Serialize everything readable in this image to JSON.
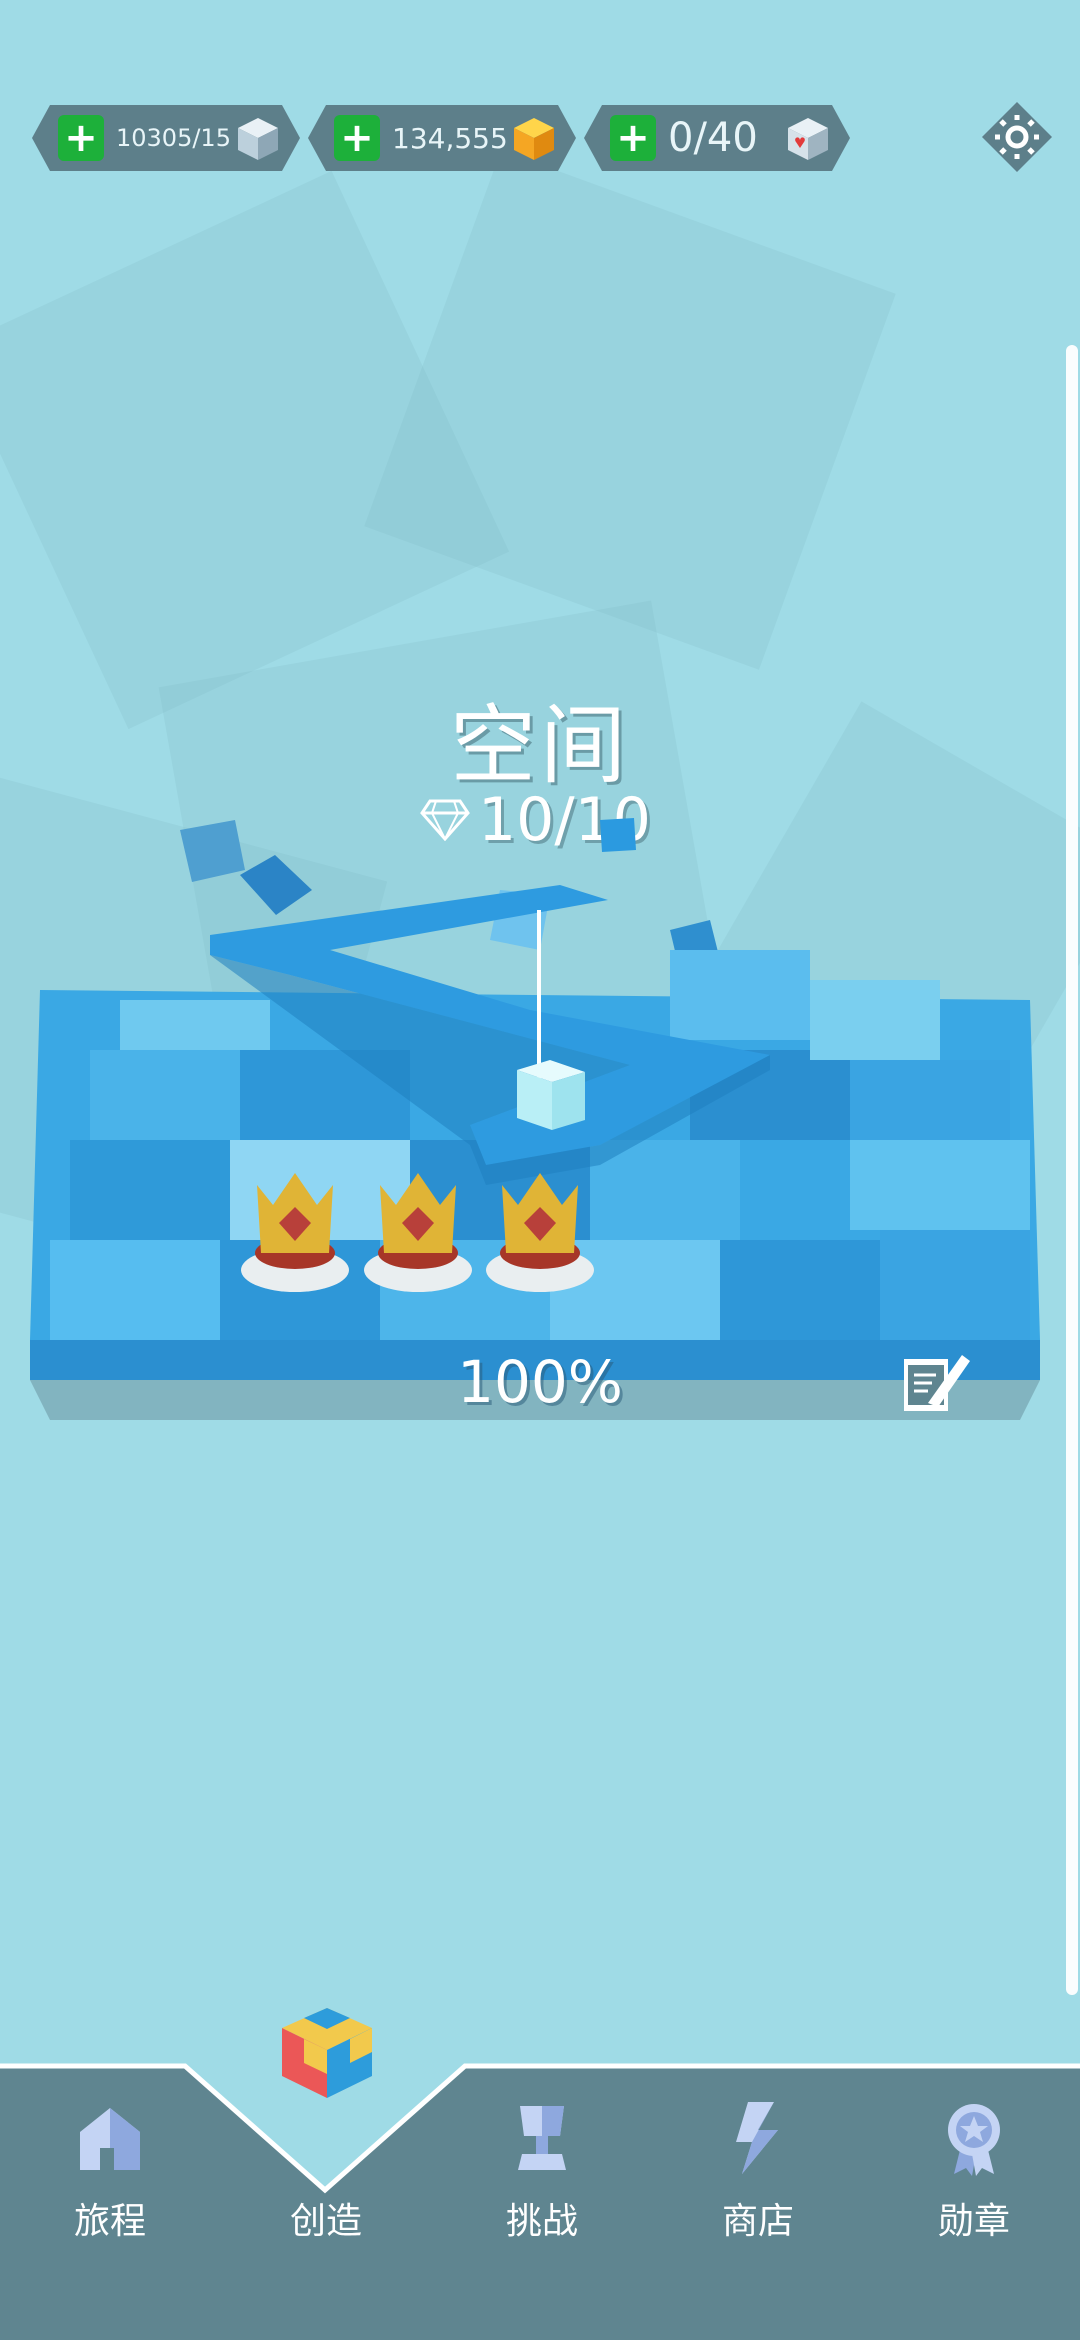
{
  "currency": {
    "cubes": "10305/15",
    "gold": "134,555",
    "hearts": "0/40"
  },
  "level": {
    "title": "空间",
    "gems": "10/10",
    "progress_text": "100%",
    "progress": 1.0,
    "crowns": 3
  },
  "nav": {
    "items": [
      {
        "label": "旅程",
        "icon": "house-icon"
      },
      {
        "label": "创造",
        "icon": "color-cube-icon",
        "active": true
      },
      {
        "label": "挑战",
        "icon": "trophy-icon"
      },
      {
        "label": "商店",
        "icon": "lightning-icon"
      },
      {
        "label": "勋章",
        "icon": "medal-icon"
      }
    ]
  },
  "colors": {
    "background": "#9fdbe6",
    "navbar": "#5f8590",
    "board_blue": "#35a9e6",
    "plus_green": "#1db03a"
  }
}
